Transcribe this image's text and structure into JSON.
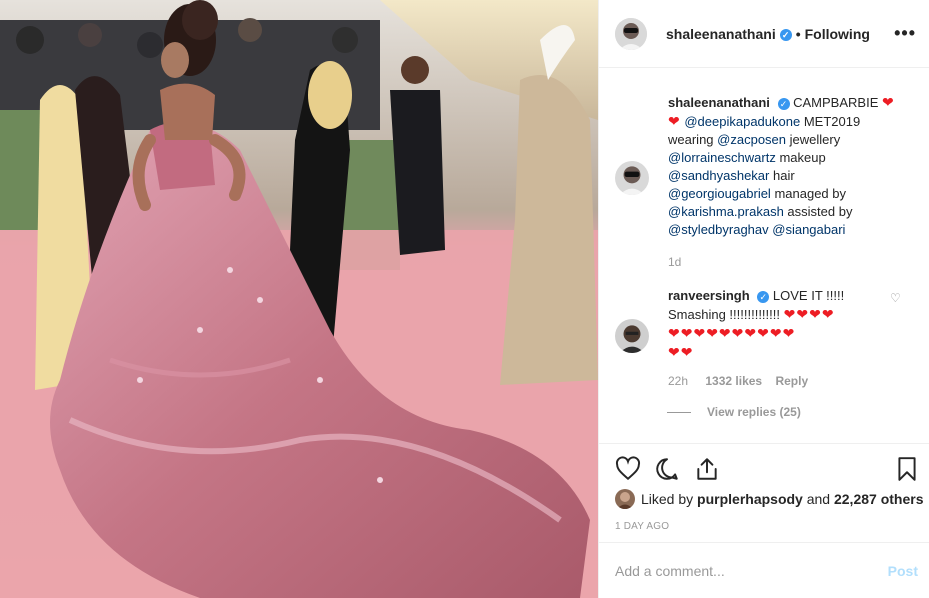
{
  "colors": {
    "accent": "#3897f0",
    "mention": "#003569",
    "heart": "#ed1d24",
    "muted": "#999999",
    "post_disabled": "#b2dffc",
    "carpet": "#e9a6ad",
    "gown": "#c97886"
  },
  "photo": {
    "icon": "photo-image"
  },
  "header": {
    "username": "shaleenanathani",
    "separator": "•",
    "follow_state": "Following",
    "more": "•••"
  },
  "caption": {
    "username": "shaleenanathani",
    "text_1": "CAMPBARBIE",
    "hearts_1": "❤",
    "hearts_2": "❤",
    "mention_1": "@deepikapadukone",
    "text_2": "MET2019 wearing",
    "mention_2": "@zacposen",
    "text_3": "jewellery",
    "mention_3": "@lorraineschwartz",
    "text_4": "makeup",
    "mention_4": "@sandhyashekar",
    "text_5": "hair",
    "mention_5": "@georgiougabriel",
    "text_6": "managed by",
    "mention_6": "@karishma.prakash",
    "text_7": "assisted by",
    "mention_7": "@styledbyraghav",
    "mention_8": "@siangabari",
    "time": "1d"
  },
  "comment": {
    "username": "ranveersingh",
    "text": "LOVE IT !!!!! Smashing !!!!!!!!!!!!!!",
    "hearts_line1": "❤❤❤❤",
    "hearts_line2": "❤❤❤❤❤❤❤❤❤❤",
    "hearts_line3": "❤❤",
    "time": "22h",
    "likes": "1332 likes",
    "reply": "Reply",
    "like_icon": "♡"
  },
  "view_replies": "View replies (25)",
  "actions": {
    "like": "heart-icon",
    "comment": "comment-icon",
    "share": "share-icon",
    "save": "bookmark-icon"
  },
  "liked_by": {
    "prefix": "Liked by",
    "user": "purplerhapsody",
    "middle": "and",
    "count": "22,287 others"
  },
  "timestamp": "1 DAY AGO",
  "add_comment": {
    "placeholder": "Add a comment...",
    "post": "Post"
  }
}
